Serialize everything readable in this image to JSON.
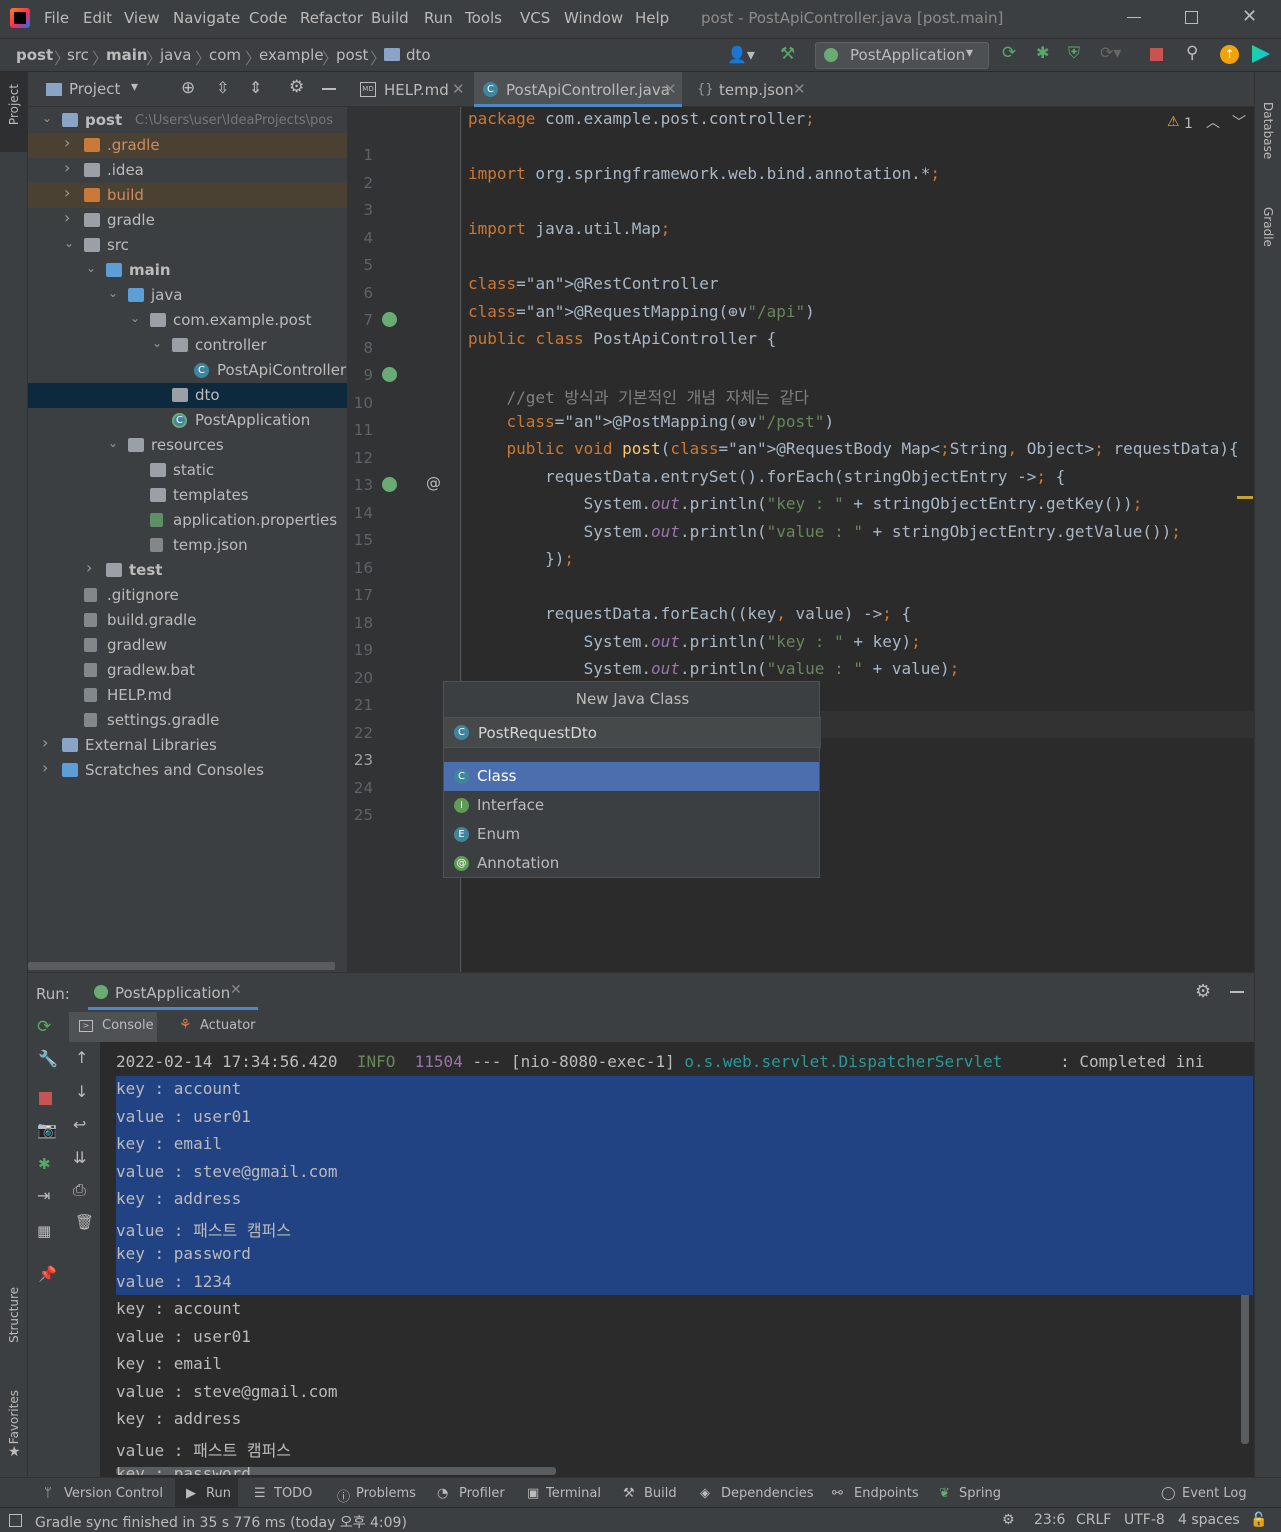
{
  "menubar": {
    "items": [
      "File",
      "Edit",
      "View",
      "Navigate",
      "Code",
      "Refactor",
      "Build",
      "Run",
      "Tools",
      "VCS",
      "Window",
      "Help"
    ],
    "title": "post - PostApiController.java [post.main]"
  },
  "breadcrumbs": [
    "post",
    "src",
    "main",
    "java",
    "com",
    "example",
    "post",
    "dto"
  ],
  "toolbar": {
    "run_config": "PostApplication"
  },
  "project_panel": {
    "title": "Project",
    "tree": [
      {
        "label": "post",
        "extra": "C:\\Users\\user\\IdeaProjects\\pos",
        "depth": 0,
        "open": true,
        "kind": "module",
        "bold": true
      },
      {
        "label": ".gradle",
        "depth": 1,
        "open": false,
        "kind": "folder-orange"
      },
      {
        "label": ".idea",
        "depth": 1,
        "open": false,
        "kind": "folder-grey"
      },
      {
        "label": "build",
        "depth": 1,
        "open": false,
        "kind": "folder-orange"
      },
      {
        "label": "gradle",
        "depth": 1,
        "open": false,
        "kind": "folder-grey"
      },
      {
        "label": "src",
        "depth": 1,
        "open": true,
        "kind": "folder-grey"
      },
      {
        "label": "main",
        "depth": 2,
        "open": true,
        "kind": "folder-blue",
        "bold": true
      },
      {
        "label": "java",
        "depth": 3,
        "open": true,
        "kind": "folder-blue"
      },
      {
        "label": "com.example.post",
        "depth": 4,
        "open": true,
        "kind": "package"
      },
      {
        "label": "controller",
        "depth": 5,
        "open": true,
        "kind": "package"
      },
      {
        "label": "PostApiController",
        "depth": 6,
        "kind": "class"
      },
      {
        "label": "dto",
        "depth": 5,
        "kind": "package",
        "selected": true
      },
      {
        "label": "PostApplication",
        "depth": 5,
        "kind": "spring-class"
      },
      {
        "label": "resources",
        "depth": 3,
        "open": true,
        "kind": "folder-res"
      },
      {
        "label": "static",
        "depth": 4,
        "kind": "folder-grey"
      },
      {
        "label": "templates",
        "depth": 4,
        "kind": "folder-grey"
      },
      {
        "label": "application.properties",
        "depth": 4,
        "kind": "props"
      },
      {
        "label": "temp.json",
        "depth": 4,
        "kind": "json"
      },
      {
        "label": "test",
        "depth": 2,
        "open": false,
        "kind": "folder-grey",
        "bold": true
      },
      {
        "label": ".gitignore",
        "depth": 1,
        "kind": "file"
      },
      {
        "label": "build.gradle",
        "depth": 1,
        "kind": "gradle"
      },
      {
        "label": "gradlew",
        "depth": 1,
        "kind": "file"
      },
      {
        "label": "gradlew.bat",
        "depth": 1,
        "kind": "file"
      },
      {
        "label": "HELP.md",
        "depth": 1,
        "kind": "md"
      },
      {
        "label": "settings.gradle",
        "depth": 1,
        "kind": "gradle"
      },
      {
        "label": "External Libraries",
        "depth": 0,
        "open": false,
        "kind": "libs"
      },
      {
        "label": "Scratches and Consoles",
        "depth": 0,
        "open": false,
        "kind": "scratch"
      }
    ]
  },
  "editor_tabs": [
    {
      "label": "HELP.md",
      "active": false
    },
    {
      "label": "PostApiController.java",
      "active": true
    },
    {
      "label": "temp.json",
      "active": false
    }
  ],
  "warnings": "1",
  "code_lines": [
    "package com.example.post.controller;",
    "",
    "import org.springframework.web.bind.annotation.*;",
    "",
    "import java.util.Map;",
    "",
    "@RestController",
    "@RequestMapping(⊕∨\"/api\")",
    "public class PostApiController {",
    "",
    "    //get 방식과 기본적인 개념 자체는 같다",
    "    @PostMapping(⊕∨\"/post\")",
    "    public void post(@RequestBody Map<String, Object> requestData){",
    "        requestData.entrySet().forEach(stringObjectEntry -> {",
    "            System.out.println(\"key : \" + stringObjectEntry.getKey());",
    "            System.out.println(\"value : \" + stringObjectEntry.getValue());",
    "        });",
    "",
    "        requestData.forEach((key, value) -> {",
    "            System.out.println(\"key : \" + key);",
    "            System.out.println(\"value : \" + value);",
    "",
    "",
    "",
    ""
  ],
  "popup": {
    "title": "New Java Class",
    "input_value": "PostRequestDto",
    "options": [
      {
        "label": "Class",
        "letter": "C",
        "selected": true
      },
      {
        "label": "Interface",
        "letter": "I"
      },
      {
        "label": "Enum",
        "letter": "E"
      },
      {
        "label": "Annotation",
        "letter": "@"
      }
    ]
  },
  "run_panel": {
    "label": "Run:",
    "tab": "PostApplication",
    "subtabs": [
      "Console",
      "Actuator"
    ],
    "log_line": {
      "timestamp": "2022-02-14 17:34:56.420",
      "level": "INFO",
      "pid": "11504",
      "thread": "--- [nio-8080-exec-1]",
      "logger": "o.s.web.servlet.DispatcherServlet",
      "message": ": Completed ini"
    },
    "output": [
      "key : account",
      "value : user01",
      "key : email",
      "value : steve@gmail.com",
      "key : address",
      "value : 패스트 캠퍼스",
      "key : password",
      "value : 1234",
      "key : account",
      "value : user01",
      "key : email",
      "value : steve@gmail.com",
      "key : address",
      "value : 패스트 캠퍼스",
      "key : password"
    ]
  },
  "side_tabs": {
    "left_top": "Project",
    "left_mid": "Structure",
    "left_bot": "Favorites",
    "right_top": "Database",
    "right_bot": "Gradle"
  },
  "bottom_tabs": [
    "Version Control",
    "Run",
    "TODO",
    "Problems",
    "Profiler",
    "Terminal",
    "Build",
    "Dependencies",
    "Endpoints",
    "Spring"
  ],
  "event_log": "Event Log",
  "status": {
    "message": "Gradle sync finished in 35 s 776 ms (today 오후 4:09)",
    "position": "23:6",
    "line_sep": "CRLF",
    "encoding": "UTF-8",
    "indent": "4 spaces"
  },
  "colors": {
    "accent": "#4b6eaf",
    "selection": "#214283",
    "background": "#2b2b2b",
    "panel": "#3c3f41"
  }
}
